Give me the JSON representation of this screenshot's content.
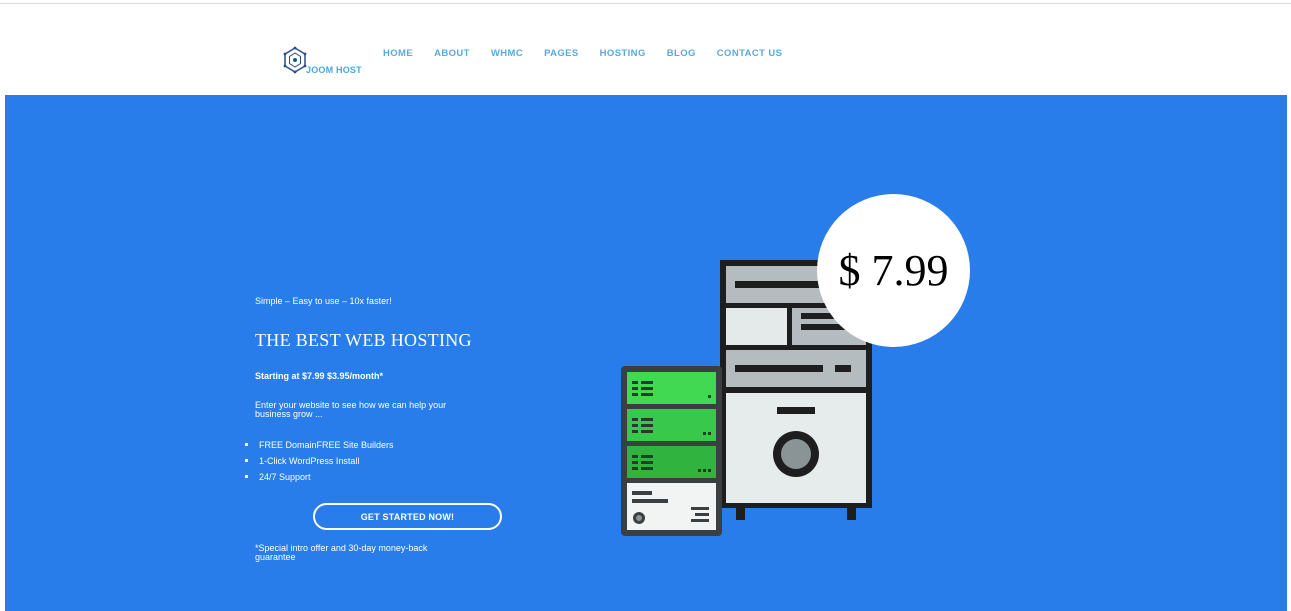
{
  "brand": {
    "name": "JOOM HOST",
    "logo_icon": "hexagon-logo-icon"
  },
  "nav": {
    "items": [
      {
        "label": "HOME"
      },
      {
        "label": "ABOUT"
      },
      {
        "label": "WHMC"
      },
      {
        "label": "PAGES"
      },
      {
        "label": "HOSTING"
      },
      {
        "label": "BLOG"
      },
      {
        "label": "CONTACT US"
      }
    ]
  },
  "hero": {
    "tagline": "Simple – Easy to use – 10x faster!",
    "headline": "THE BEST WEB HOSTING",
    "pricing_line": "Starting at $7.99 $3.95/month*",
    "lead": "Enter your website to see how we can help your business grow ...",
    "features": [
      "FREE DomainFREE Site Builders",
      "1-Click WordPress Install",
      "24/7 Support"
    ],
    "cta_label": "GET STARTED NOW!",
    "disclaimer": "*Special intro offer and 30-day money-back guarantee",
    "price_badge": "$ 7.99",
    "illustration": "server-rack-illustration"
  },
  "colors": {
    "hero_background": "#287deb",
    "nav_link": "#5aa9dc",
    "server_green": "#3fd44f",
    "server_gray": "#e6ebeb"
  }
}
